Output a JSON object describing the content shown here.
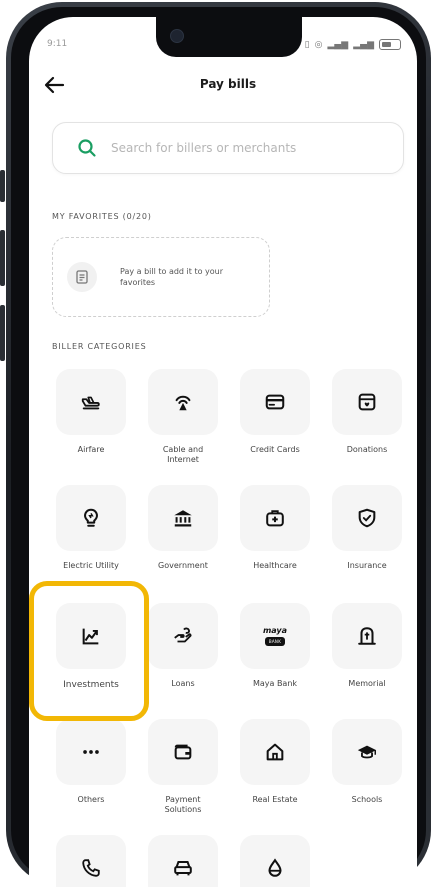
{
  "status": {
    "left": "9:11"
  },
  "header": {
    "title": "Pay bills"
  },
  "search": {
    "placeholder": "Search for billers or merchants"
  },
  "favorites": {
    "heading": "MY FAVORITES (0/20)",
    "empty_text": "Pay a bill to add it to your favorites"
  },
  "categories": {
    "heading": "BILLER CATEGORIES",
    "items": [
      {
        "label": "Airfare",
        "icon": "plane-icon"
      },
      {
        "label": "Cable and Internet",
        "icon": "antenna-icon"
      },
      {
        "label": "Credit Cards",
        "icon": "credit-card-icon"
      },
      {
        "label": "Donations",
        "icon": "donation-box-icon"
      },
      {
        "label": "Electric Utility",
        "icon": "lightbulb-icon"
      },
      {
        "label": "Government",
        "icon": "government-building-icon"
      },
      {
        "label": "Healthcare",
        "icon": "medical-kit-icon"
      },
      {
        "label": "Insurance",
        "icon": "shield-icon"
      },
      {
        "label": "Investments",
        "icon": "trend-chart-icon"
      },
      {
        "label": "Loans",
        "icon": "money-hand-icon"
      },
      {
        "label": "Maya Bank",
        "icon": "maya-bank-logo",
        "logo_top": "maya",
        "logo_bottom": "BANK"
      },
      {
        "label": "Memorial",
        "icon": "memorial-icon"
      },
      {
        "label": "Others",
        "icon": "more-dots-icon"
      },
      {
        "label": "Payment Solutions",
        "icon": "wallet-icon"
      },
      {
        "label": "Real Estate",
        "icon": "house-icon"
      },
      {
        "label": "Schools",
        "icon": "graduation-cap-icon"
      },
      {
        "label": "",
        "icon": "phone-icon"
      },
      {
        "label": "",
        "icon": "car-icon"
      },
      {
        "label": "",
        "icon": "water-drop-icon"
      }
    ]
  },
  "highlight_color": "#f2b705",
  "accent_color": "#1a9e62"
}
